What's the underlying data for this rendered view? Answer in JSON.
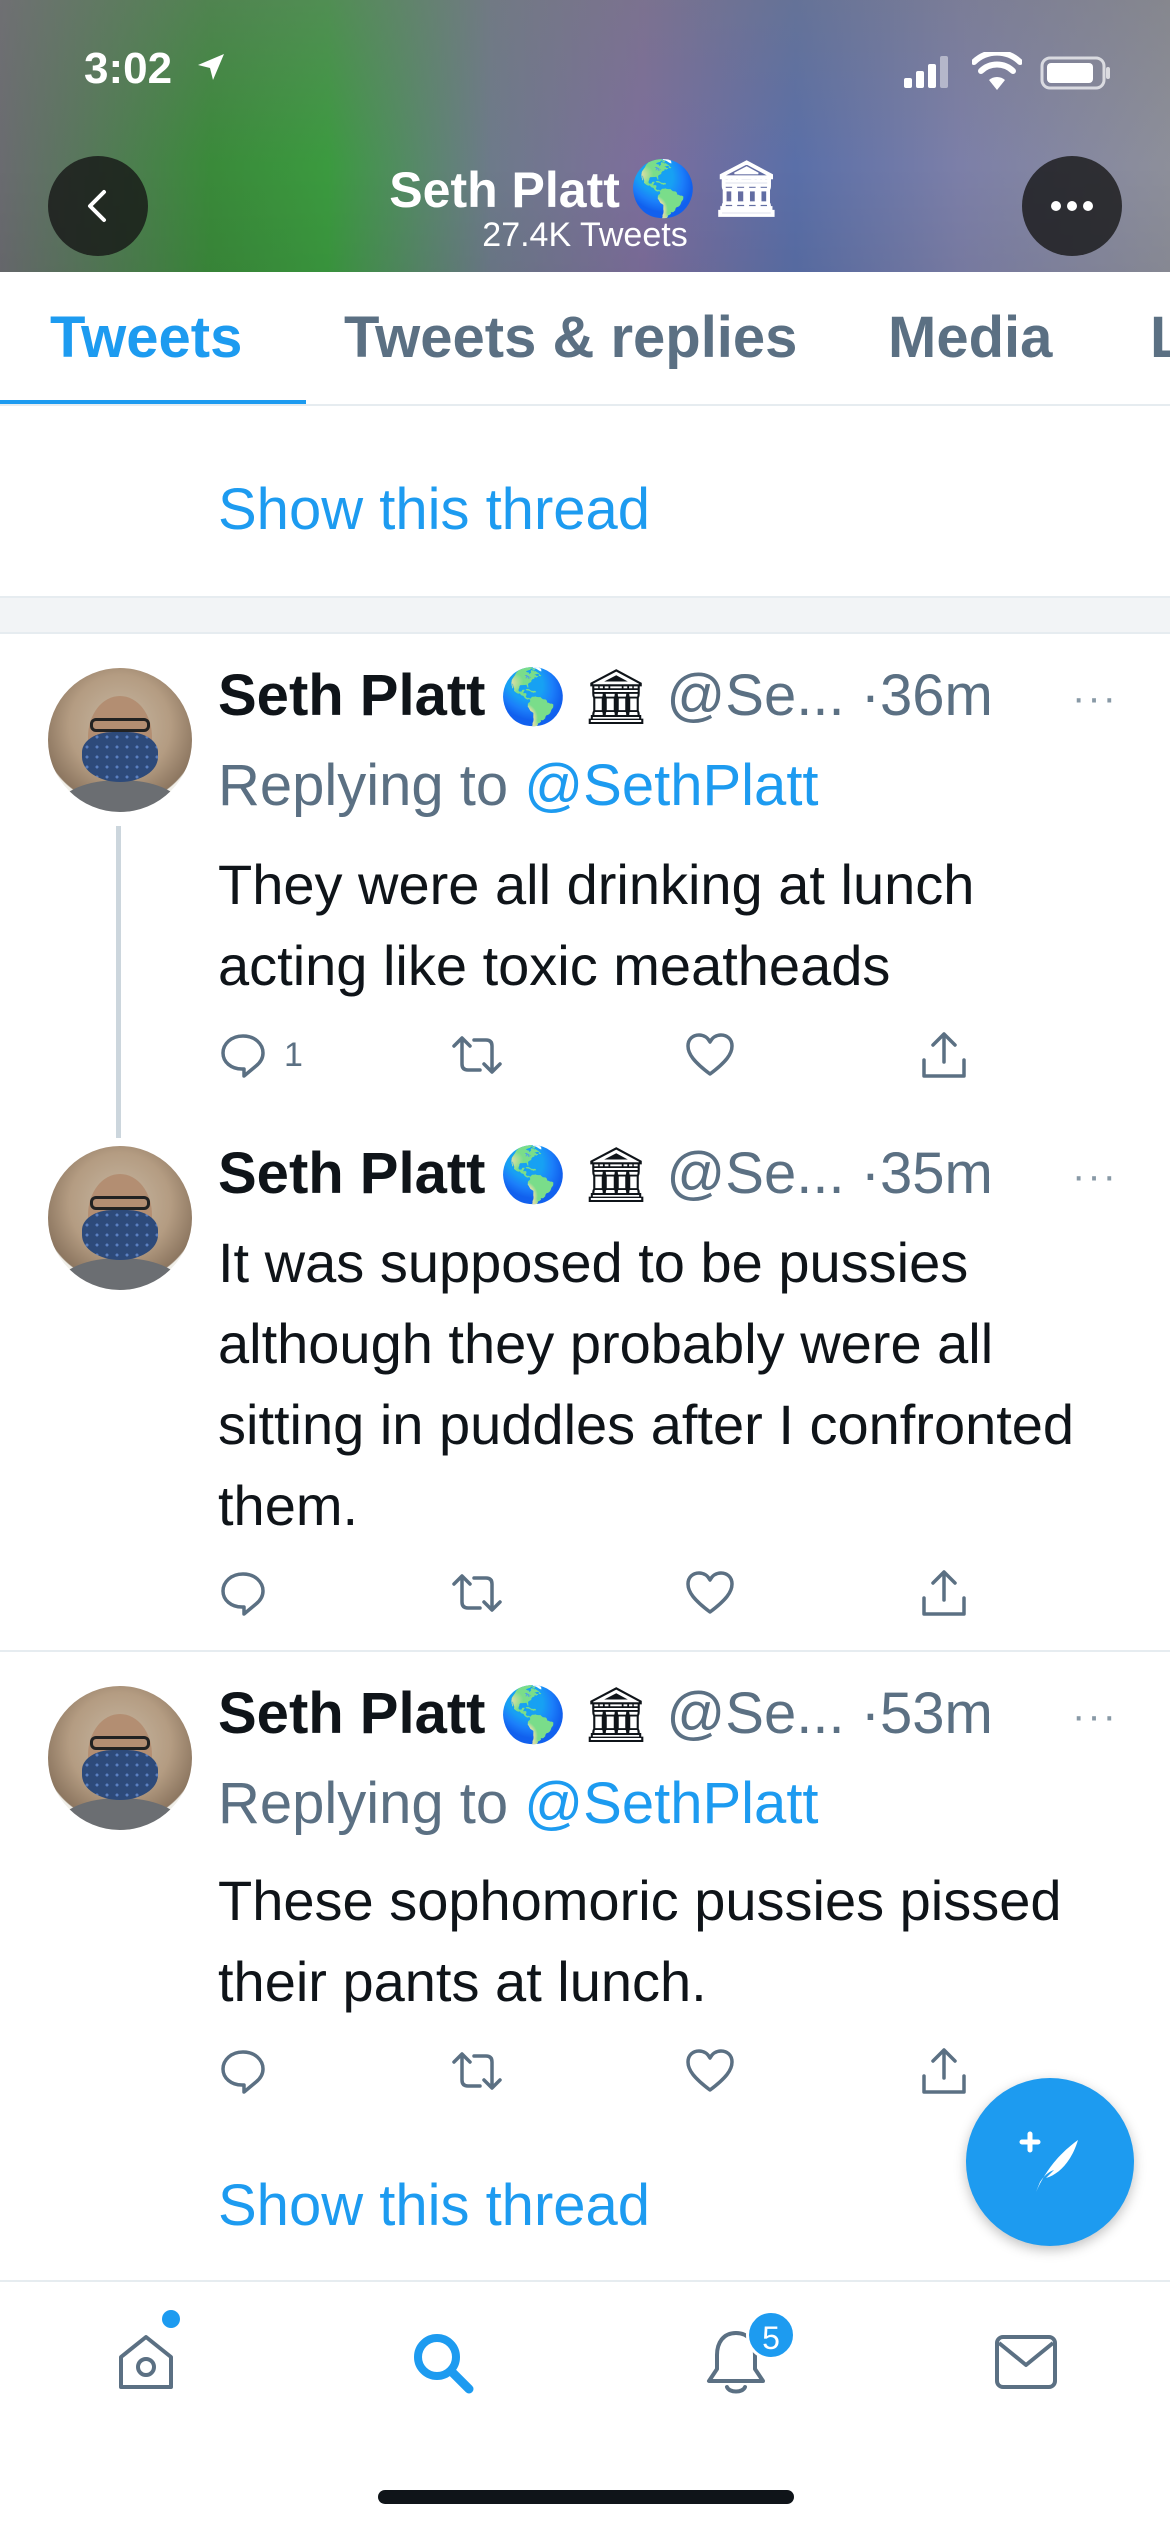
{
  "status_bar": {
    "time": "3:02"
  },
  "header": {
    "name": "Seth Platt",
    "badges": "🌎 🏛",
    "tweet_count": "27.4K Tweets"
  },
  "tabs": [
    {
      "label": "Tweets",
      "active": true
    },
    {
      "label": "Tweets & replies",
      "active": false
    },
    {
      "label": "Media",
      "active": false
    },
    {
      "label": "L",
      "active": false
    }
  ],
  "show_thread_label": "Show this thread",
  "tweets": [
    {
      "name": "Seth Platt",
      "badges": "🌎 🏛",
      "handle": "@Se...",
      "time": "·36m",
      "replying_prefix": "Replying to",
      "replying_to": "@SethPlatt",
      "text": "They were all drinking at lunch acting like toxic meatheads",
      "reply_count": "1"
    },
    {
      "name": "Seth Platt",
      "badges": "🌎 🏛",
      "handle": "@Se...",
      "time": "·35m",
      "text": "It was supposed to be pussies although they probably were all sitting in puddles after I confronted them.",
      "reply_count": ""
    },
    {
      "name": "Seth Platt",
      "badges": "🌎 🏛",
      "handle": "@Se...",
      "time": "·53m",
      "replying_prefix": "Replying to",
      "replying_to": "@SethPlatt",
      "text": "These sophomoric pussies pissed their pants at lunch.",
      "reply_count": ""
    }
  ],
  "more_label": "···",
  "bottom_nav": {
    "notifications_badge": "5",
    "active": "search"
  },
  "colors": {
    "accent": "#1d9bf0",
    "secondary_text": "#5b7083"
  }
}
